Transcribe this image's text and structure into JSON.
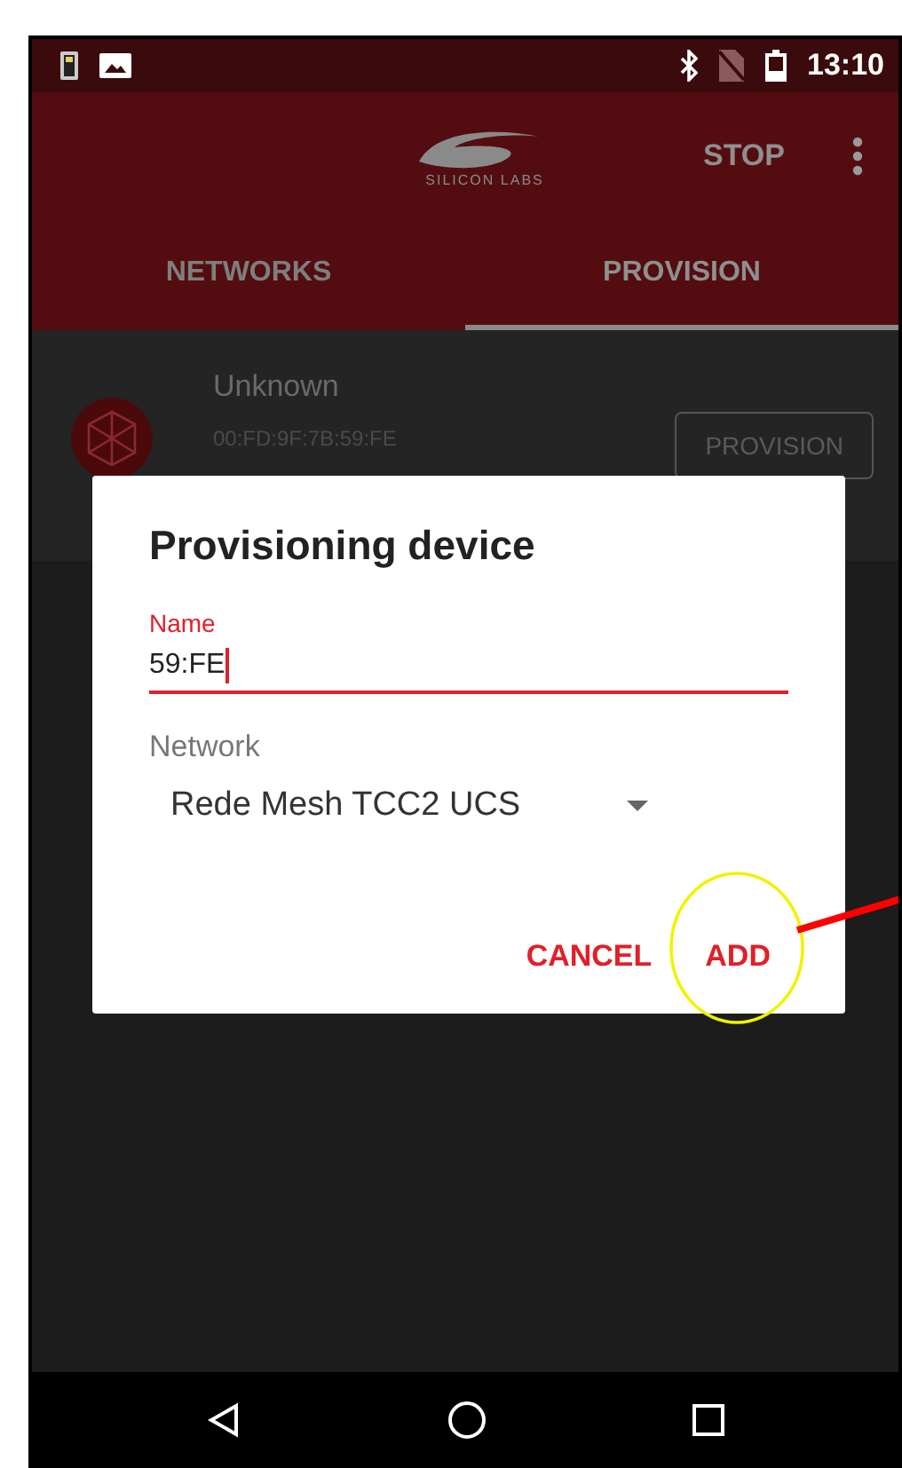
{
  "status_bar": {
    "time": "13:10"
  },
  "app_bar": {
    "logo_text": "SILICON LABS",
    "action": "STOP"
  },
  "tabs": [
    {
      "label": "NETWORKS",
      "selected": false
    },
    {
      "label": "PROVISION",
      "selected": true
    }
  ],
  "device": {
    "name": "Unknown",
    "address": "00:FD:9F:7B:59:FE",
    "button": "PROVISION"
  },
  "dialog": {
    "title": "Provisioning device",
    "name_label": "Name",
    "name_value": "59:FE",
    "network_label": "Network",
    "network_value": "Rede Mesh TCC2 UCS",
    "buttons": [
      {
        "label": "CANCEL"
      },
      {
        "label": "ADD"
      }
    ]
  }
}
